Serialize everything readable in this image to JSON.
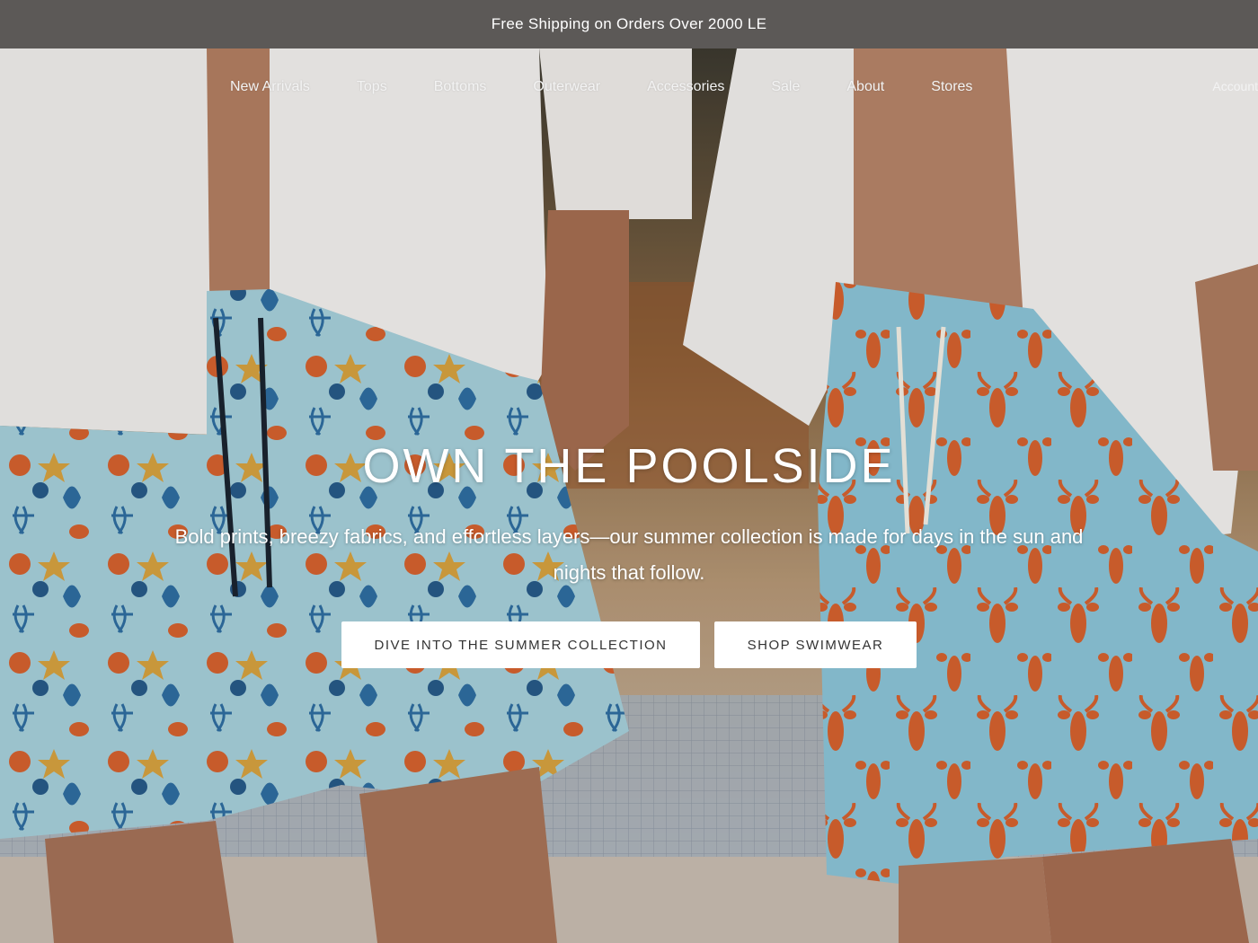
{
  "announcement": {
    "text": "Free Shipping on Orders Over 2000 LE"
  },
  "nav": {
    "links": [
      "New Arrivals",
      "Tops",
      "Bottoms",
      "Outerwear",
      "Accessories",
      "Sale",
      "About",
      "Stores"
    ],
    "account_label": "Account"
  },
  "hero": {
    "title": "OWN THE POOLSIDE",
    "subtitle": "Bold prints, breezy fabrics, and effortless layers—our summer collection is made for days in the sun and nights that follow.",
    "primary_cta": "DIVE INTO THE SUMMER COLLECTION",
    "secondary_cta": "SHOP SWIMWEAR"
  },
  "colors": {
    "announcement_bg": "#5c5957",
    "shirt": "#f4f1ef",
    "shorts_left": "#a9d3de",
    "shorts_right": "#8ec7db",
    "print_orange": "#d8632f",
    "print_blue": "#2f6fa3",
    "skin": "#b07d60",
    "button_bg": "#ffffff"
  }
}
